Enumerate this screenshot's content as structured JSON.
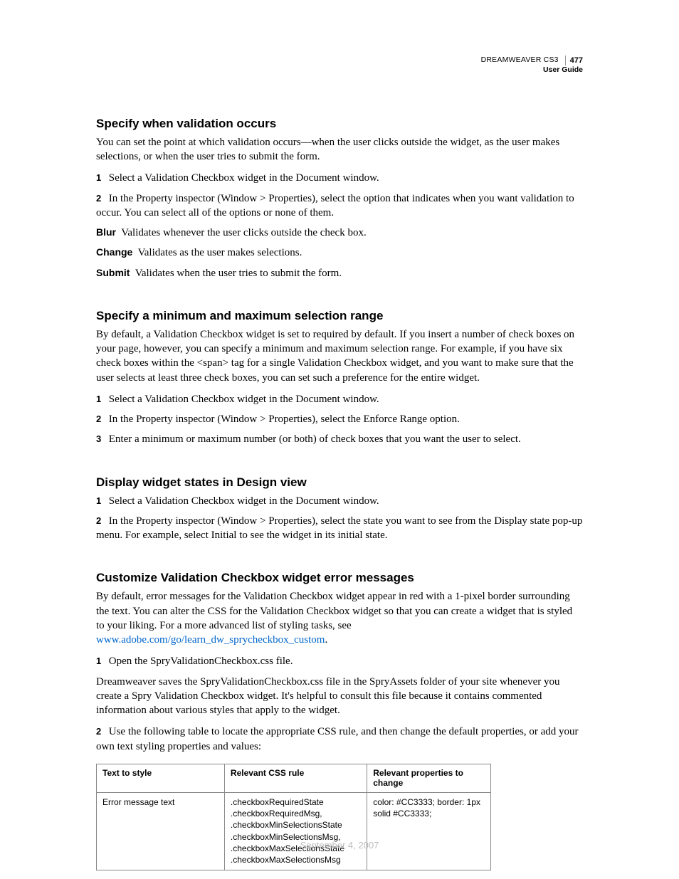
{
  "header": {
    "product": "DREAMWEAVER CS3",
    "guide": "User Guide",
    "page_number": "477"
  },
  "sections": [
    {
      "heading": "Specify when validation occurs",
      "intro": "You can set the point at which validation occurs—when the user clicks outside the widget, as the user makes selections, or when the user tries to submit the form.",
      "steps": [
        "Select a Validation Checkbox widget in the Document window.",
        "In the Property inspector (Window > Properties), select the option that indicates when you want validation to occur. You can select all of the options or none of them."
      ],
      "defs": [
        {
          "term": "Blur",
          "text": "Validates whenever the user clicks outside the check box."
        },
        {
          "term": "Change",
          "text": "Validates as the user makes selections."
        },
        {
          "term": "Submit",
          "text": "Validates when the user tries to submit the form."
        }
      ]
    },
    {
      "heading": "Specify a minimum and maximum selection range",
      "intro": "By default, a Validation Checkbox widget is set to required by default. If you insert a number of check boxes on your page, however, you can specify a minimum and maximum selection range. For example, if you have six check boxes within the <span> tag for a single Validation Checkbox widget, and you want to make sure that the user selects at least three check boxes, you can set such a preference for the entire widget.",
      "steps": [
        "Select a Validation Checkbox widget in the Document window.",
        "In the Property inspector (Window > Properties), select the Enforce Range option.",
        "Enter a minimum or maximum number (or both) of check boxes that you want the user to select."
      ]
    },
    {
      "heading": "Display widget states in Design view",
      "steps": [
        "Select a Validation Checkbox widget in the Document window.",
        "In the Property inspector (Window > Properties), select the state you want to see from the Display state pop-up menu. For example, select Initial to see the widget in its initial state."
      ]
    },
    {
      "heading": "Customize Validation Checkbox widget error messages",
      "intro_pre": "By default, error messages for the Validation Checkbox widget appear in red with a 1-pixel border surrounding the text. You can alter the CSS for the Validation Checkbox widget so that you can create a widget that is styled to your liking. For a more advanced list of styling tasks, see ",
      "intro_link": "www.adobe.com/go/learn_dw_sprycheckbox_custom",
      "intro_post": ".",
      "steps_a": [
        "Open the SpryValidationCheckbox.css file."
      ],
      "mid_para": "Dreamweaver saves the SpryValidationCheckbox.css file in the SpryAssets folder of your site whenever you create a Spry Validation Checkbox widget. It's helpful to consult this file because it contains commented information about various styles that apply to the widget.",
      "steps_b": [
        "Use the following table to locate the appropriate CSS rule, and then change the default properties, or add your own text styling properties and values:"
      ],
      "table": {
        "headers": [
          "Text to style",
          "Relevant CSS rule",
          "Relevant properties to change"
        ],
        "rows": [
          [
            "Error message text",
            ".checkboxRequiredState .checkboxRequiredMsg, .checkboxMinSelectionsState .checkboxMinSelectionsMsg, .checkboxMaxSelectionsState .checkboxMaxSelectionsMsg",
            "color: #CC3333; border: 1px solid #CC3333;"
          ]
        ]
      }
    }
  ],
  "footer_date": "September 4, 2007"
}
